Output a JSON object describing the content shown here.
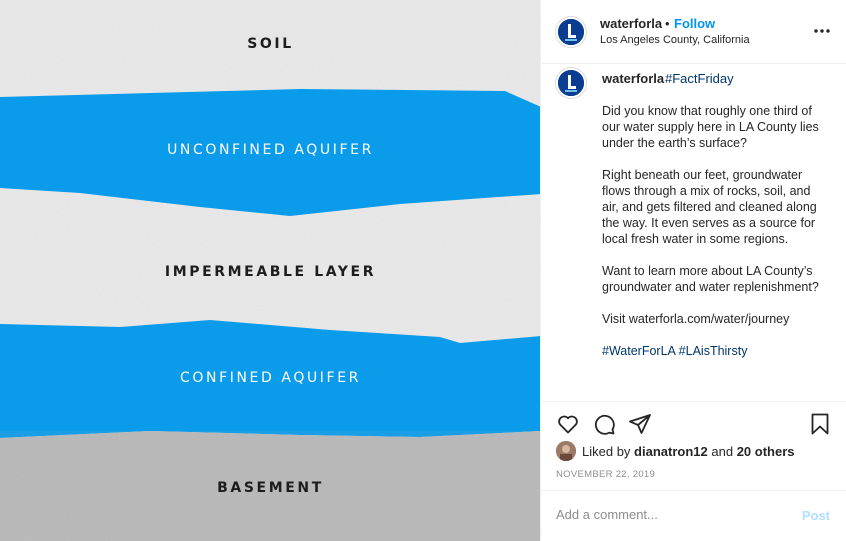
{
  "image": {
    "layers": [
      "SOIL",
      "UNCONFINED AQUIFER",
      "IMPERMEABLE LAYER",
      "CONFINED AQUIFER",
      "BASEMENT"
    ],
    "colors": {
      "soil": "#ebebeb",
      "water": "#0a9bea",
      "basement": "#bcbcbc",
      "dark_text": "#1d1d1d",
      "light_text": "#ffffff"
    }
  },
  "header": {
    "username": "waterforla",
    "separator": "•",
    "follow_label": "Follow",
    "location": "Los Angeles County, California",
    "more_icon": "more-horizontal-icon"
  },
  "caption": {
    "username": "waterforla",
    "hashtag": "#FactFriday",
    "paragraphs": [
      "Did you know that roughly one third of our water supply here in LA County lies under the earth’s surface?",
      "Right beneath our feet, groundwater flows through a mix of rocks, soil, and air, and gets filtered and cleaned along the way. It even serves as a source for local fresh water in some regions.",
      "Want to learn more about LA County’s groundwater and water replenishment?",
      "Visit waterforla.com/water/journey"
    ],
    "tags": [
      "#WaterForLA",
      "#LAisThirsty"
    ]
  },
  "actions": {
    "icons": [
      "heart-icon",
      "comment-icon",
      "share-icon",
      "bookmark-icon"
    ]
  },
  "likes": {
    "prefix": "Liked by",
    "user": "dianatron12",
    "and": "and",
    "others": "20 others"
  },
  "date": "NOVEMBER 22, 2019",
  "comment": {
    "placeholder": "Add a comment...",
    "post_label": "Post"
  },
  "colors": {
    "accent": "#0095f6",
    "hashtag": "#00376b",
    "muted": "#8e8e8e",
    "post_disabled": "#b2dffc"
  }
}
